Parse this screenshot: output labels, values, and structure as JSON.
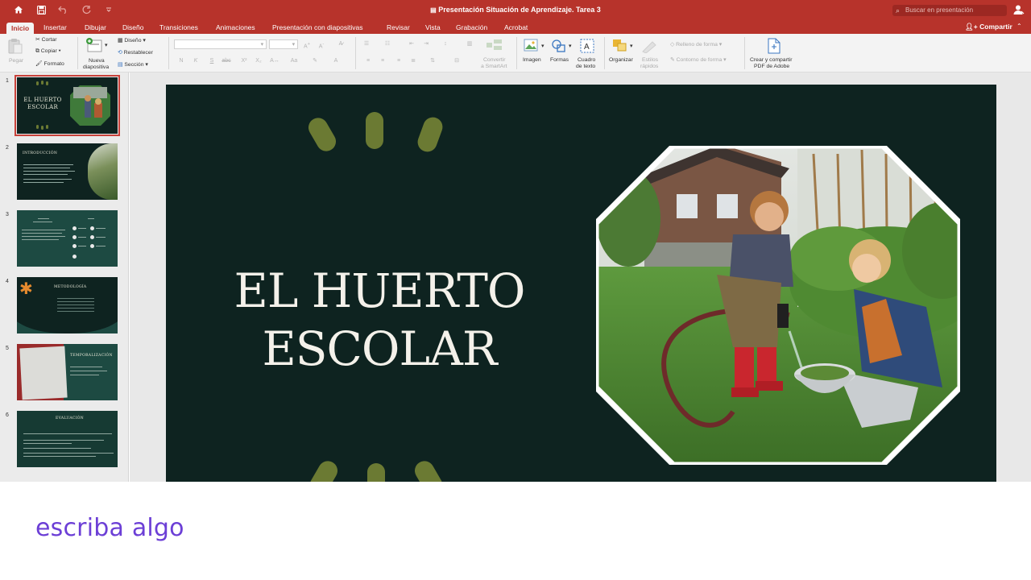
{
  "window": {
    "title": "Presentación Situación de Aprendizaje. Tarea 3",
    "search_placeholder": "Buscar en presentación"
  },
  "tabs": [
    "Inicio",
    "Insertar",
    "Dibujar",
    "Diseño",
    "Transiciones",
    "Animaciones",
    "Presentación con diapositivas",
    "Revisar",
    "Vista",
    "Grabación",
    "Acrobat"
  ],
  "active_tab": "Inicio",
  "share_label": "Compartir",
  "ribbon": {
    "paste": "Pegar",
    "cut": "Cortar",
    "copy": "Copiar",
    "format": "Formato",
    "new_slide_1": "Nueva",
    "new_slide_2": "diapositiva",
    "layout": "Diseño",
    "reset": "Restablecer",
    "section": "Sección",
    "convert_1": "Convertir",
    "convert_2": "a SmartArt",
    "image": "Imagen",
    "shapes": "Formas",
    "textbox_1": "Cuadro",
    "textbox_2": "de texto",
    "arrange": "Organizar",
    "quick_styles_1": "Estilos",
    "quick_styles_2": "rápidos",
    "shape_fill": "Relleno de forma",
    "shape_outline": "Contorno de forma",
    "adobe_1": "Crear y compartir",
    "adobe_2": "PDF de Adobe",
    "bold": "N",
    "italic": "K",
    "underline": "S",
    "strike": "abc"
  },
  "slides": [
    {
      "number": "1",
      "title": "EL HUERTO ESCOLAR"
    },
    {
      "number": "2",
      "title": "INTRODUCCIÓN"
    },
    {
      "number": "3",
      "title": ""
    },
    {
      "number": "4",
      "title": "METODOLOGÍA"
    },
    {
      "number": "5",
      "title": "TEMPORALIZACIÓN"
    },
    {
      "number": "6",
      "title": "EVALUACIÓN"
    }
  ],
  "main_slide": {
    "title_line1": "EL HUERTO",
    "title_line2": "ESCOLAR"
  },
  "caption": "escriba algo",
  "colors": {
    "accent": "#b7332b",
    "slide_bg": "#0e2320",
    "leaf": "#6b7a33",
    "caption": "#6c3fd6"
  }
}
